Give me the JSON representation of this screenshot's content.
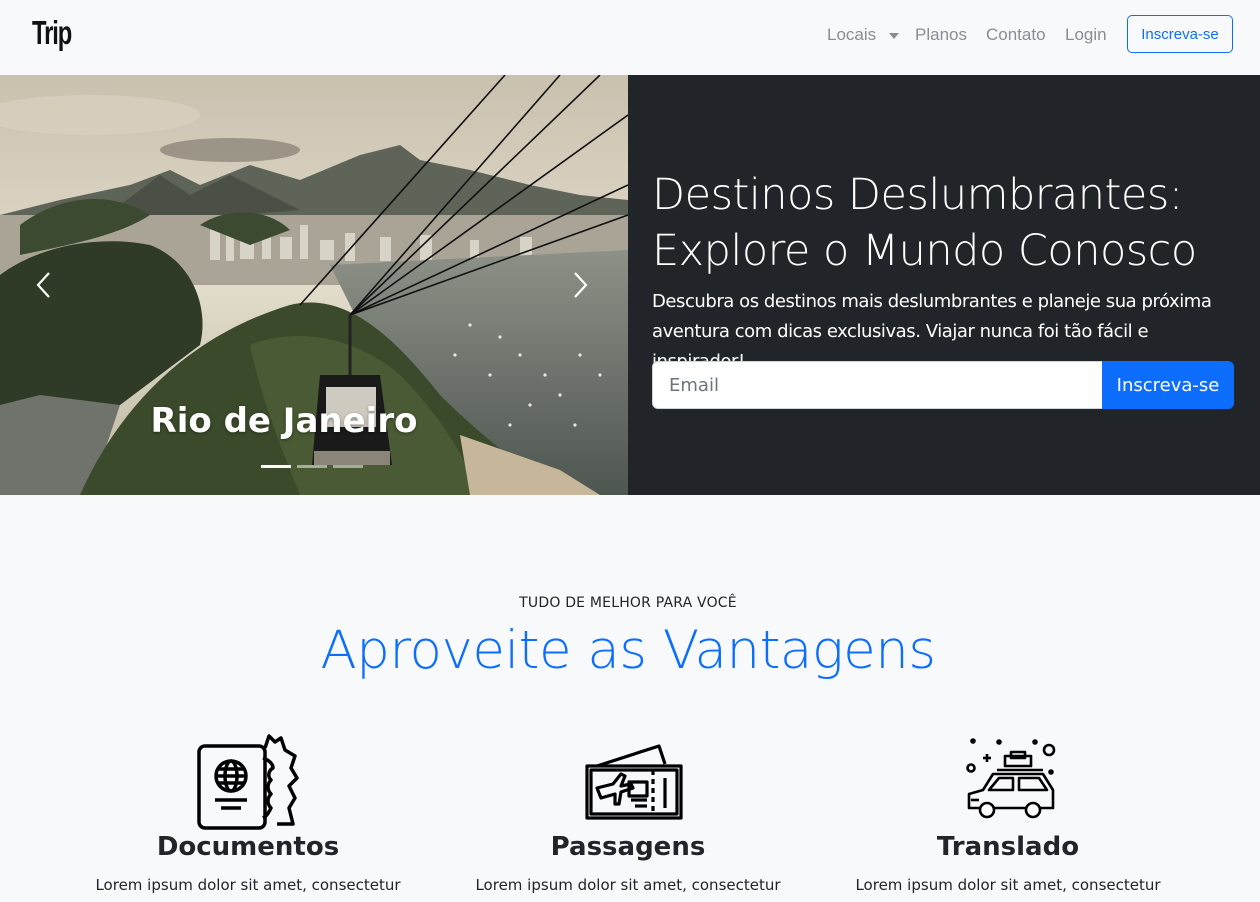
{
  "navbar": {
    "brand": "Trip",
    "links": [
      "Locais",
      "Planos",
      "Contato",
      "Login"
    ],
    "cta": "Inscreva-se"
  },
  "carousel": {
    "caption": "Rio de Janeiro",
    "slide_count": 3,
    "active_slide": 1
  },
  "hero": {
    "title_line1": "Destinos Deslumbrantes:",
    "title_line2": "Explore o Mundo Conosco",
    "text_line1": "Descubra os destinos mais deslumbrantes e planeje sua próxima",
    "text_line2": "aventura com dicas exclusivas. Viajar nunca foi tão fácil e inspirador!",
    "email_placeholder": "Email",
    "button": "Inscreva-se"
  },
  "features": {
    "eyebrow": "TUDO DE MELHOR PARA VOCÊ",
    "title": "Aproveite as Vantagens",
    "items": [
      {
        "title": "Documentos",
        "text": "Lorem ipsum dolor sit amet, consectetur",
        "icon": "passport-icon"
      },
      {
        "title": "Passagens",
        "text": "Lorem ipsum dolor sit amet, consectetur",
        "icon": "ticket-icon"
      },
      {
        "title": "Translado",
        "text": "Lorem ipsum dolor sit amet, consectetur",
        "icon": "car-icon"
      }
    ]
  },
  "colors": {
    "primary": "#0d6efd",
    "dark": "#212529",
    "light": "#f8f9fa",
    "nav_muted": "#8a8d91"
  }
}
